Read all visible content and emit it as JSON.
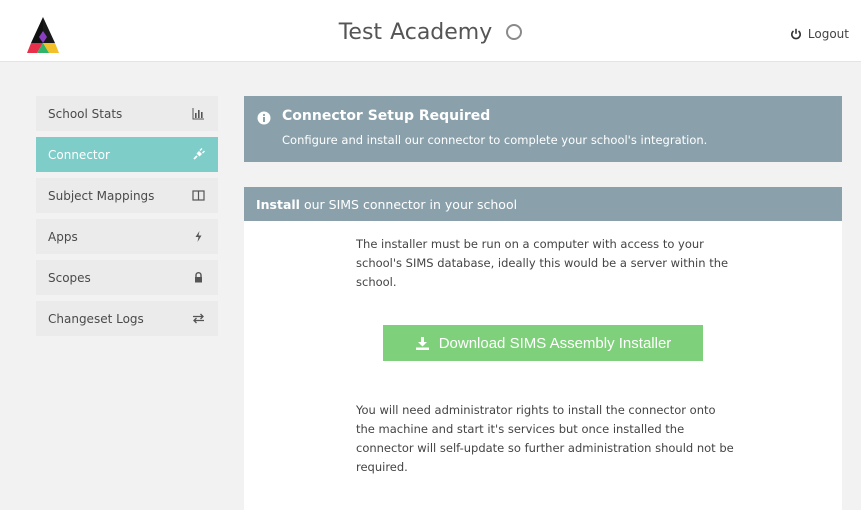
{
  "header": {
    "title_part1": "Test",
    "title_part2": "Academy",
    "logout_label": "Logout"
  },
  "sidebar": {
    "items": [
      {
        "label": "School Stats",
        "icon": "bar-chart-icon"
      },
      {
        "label": "Connector",
        "icon": "plug-icon",
        "active": true
      },
      {
        "label": "Subject Mappings",
        "icon": "columns-icon"
      },
      {
        "label": "Apps",
        "icon": "bolt-icon"
      },
      {
        "label": "Scopes",
        "icon": "lock-icon"
      },
      {
        "label": "Changeset Logs",
        "icon": "exchange-icon"
      }
    ]
  },
  "alert": {
    "title": "Connector Setup Required",
    "text": "Configure and install our connector to complete your school's integration."
  },
  "panel": {
    "heading_bold": "Install",
    "heading_rest": " our SIMS connector in your school",
    "para1": "The installer must be run on a computer with access to your school's SIMS database, ideally this would be a server within the school.",
    "download_label": "Download SIMS Assembly Installer",
    "para2": "You will need administrator rights to install the connector onto the machine and start it's services but once installed the connector will self-update so further administration should not be required."
  },
  "colors": {
    "accent_teal": "#7ecdc9",
    "header_slate": "#8aa1ac",
    "download_green": "#7fd07a"
  }
}
